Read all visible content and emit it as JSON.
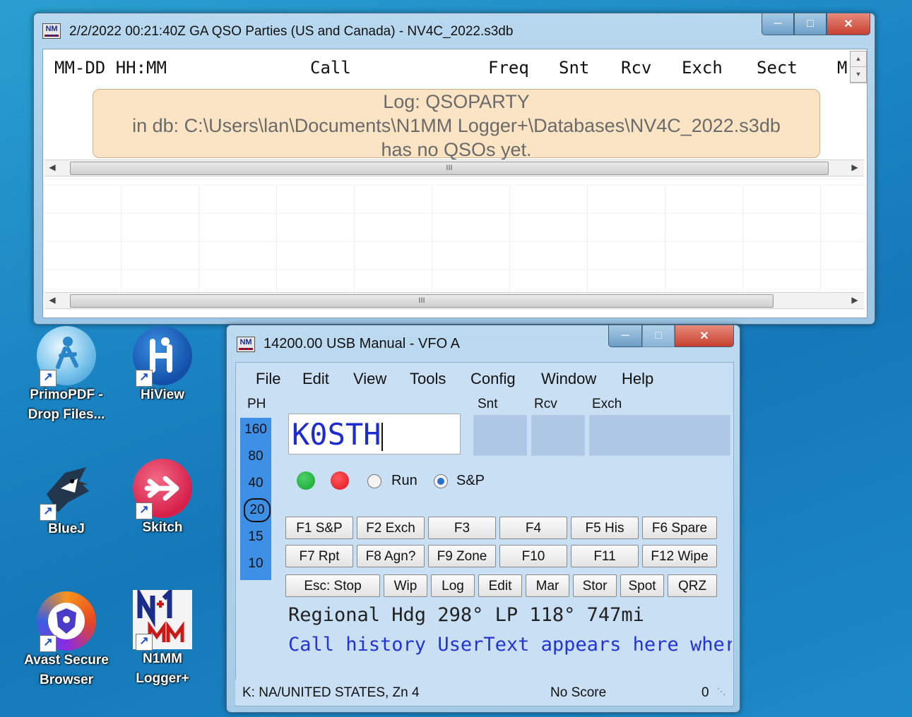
{
  "log_window": {
    "title": "2/2/2022 00:21:40Z GA QSO Parties (US and Canada) - NV4C_2022.s3db",
    "columns": [
      "MM-DD HH:MM",
      "Call",
      "Freq",
      "Snt",
      "Rcv",
      "Exch",
      "Sect",
      "M"
    ],
    "message_line1": "Log: QSOPARTY",
    "message_line2": "in db: C:\\Users\\lan\\Documents\\N1MM Logger+\\Databases\\NV4C_2022.s3db",
    "message_line3": "has no QSOs yet.",
    "scroll_grip": "III"
  },
  "desktop_icons": [
    {
      "label_line1": "PrimoPDF -",
      "label_line2": "Drop Files...",
      "icon": "primopdf-icon"
    },
    {
      "label_line1": "HiView",
      "label_line2": "",
      "icon": "hiview-icon"
    },
    {
      "label_line1": "BlueJ",
      "label_line2": "",
      "icon": "bluej-icon"
    },
    {
      "label_line1": "Skitch",
      "label_line2": "",
      "icon": "skitch-icon"
    },
    {
      "label_line1": "Avast Secure",
      "label_line2": "Browser",
      "icon": "avast-browser-icon"
    },
    {
      "label_line1": "N1MM",
      "label_line2": "Logger+",
      "icon": "n1mm-icon"
    }
  ],
  "entry_window": {
    "title": "14200.00 USB Manual - VFO A",
    "menu": [
      "File",
      "Edit",
      "View",
      "Tools",
      "Config",
      "Window",
      "Help"
    ],
    "mode": "PH",
    "bands": [
      "160",
      "80",
      "40",
      "20",
      "15",
      "10"
    ],
    "selected_band": "20",
    "field_labels": {
      "snt": "Snt",
      "rcv": "Rcv",
      "exch": "Exch"
    },
    "call_value": "K0STH",
    "run_label": "Run",
    "sp_label": "S&P",
    "selected_mode": "S&P",
    "fkeys_row1": [
      "F1 S&P",
      "F2 Exch",
      "F3",
      "F4",
      "F5 His",
      "F6 Spare"
    ],
    "fkeys_row2": [
      "F7 Rpt",
      "F8 Agn?",
      "F9 Zone",
      "F10",
      "F11",
      "F12 Wipe"
    ],
    "buttons_row3": [
      "Esc: Stop",
      "Wip",
      "Log",
      "Edit",
      "Mar",
      "Stor",
      "Spot",
      "QRZ"
    ],
    "info_line": "Regional Hdg 298° LP 118° 747mi",
    "call_history_line": "Call history UserText appears here wher",
    "status_country": "K: NA/UNITED STATES, Zn 4",
    "status_score": "No Score",
    "status_count": "0"
  },
  "colors": {
    "desktop": "#1c86c4",
    "call_text": "#1c2cd0",
    "band_column": "#3e8fe6",
    "message_bg": "#fbe4c4",
    "green_light": "#12a52c",
    "red_light": "#e01020"
  }
}
